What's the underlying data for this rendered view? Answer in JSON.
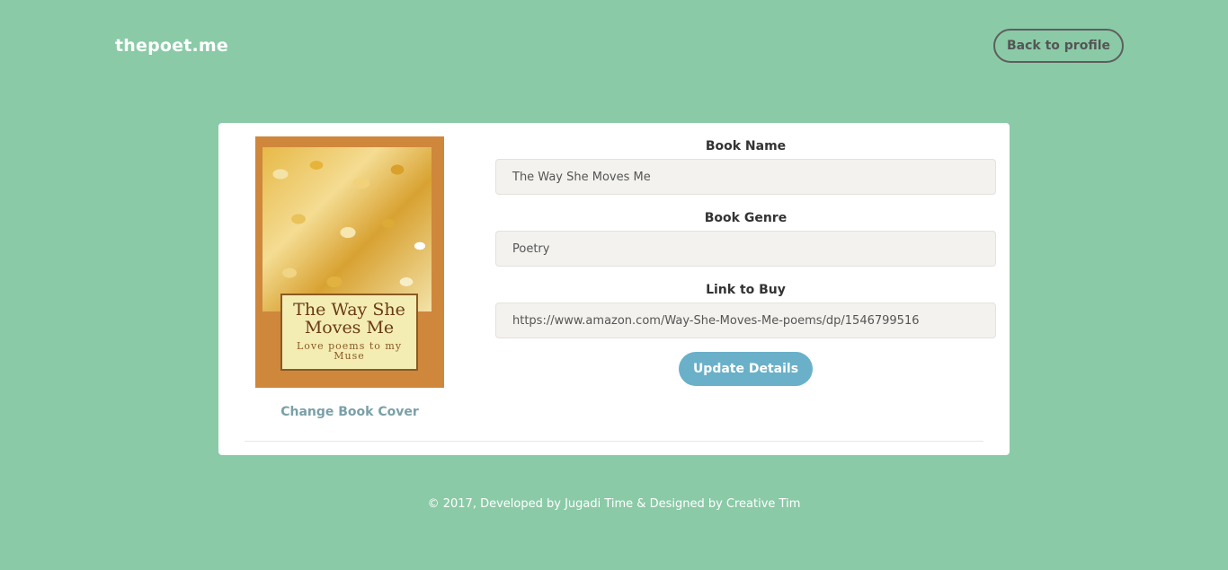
{
  "navbar": {
    "brand": "thepoet.me",
    "back_label": "Back to profile"
  },
  "book": {
    "cover": {
      "title": "The Way She Moves Me",
      "subtitle": "Love poems to my Muse"
    },
    "change_cover_label": "Change Book Cover",
    "fields": [
      {
        "label": "Book Name",
        "value": "The Way She Moves Me"
      },
      {
        "label": "Book Genre",
        "value": "Poetry"
      },
      {
        "label": "Link to Buy",
        "value": "https://www.amazon.com/Way-She-Moves-Me-poems/dp/1546799516"
      }
    ],
    "update_label": "Update Details"
  },
  "footer": {
    "text": "© 2017, Developed by Jugadi Time & Designed by Creative Tim"
  },
  "colors": {
    "background": "#8acaa7",
    "button": "#6ab0c9",
    "cover": "#cf873c"
  }
}
